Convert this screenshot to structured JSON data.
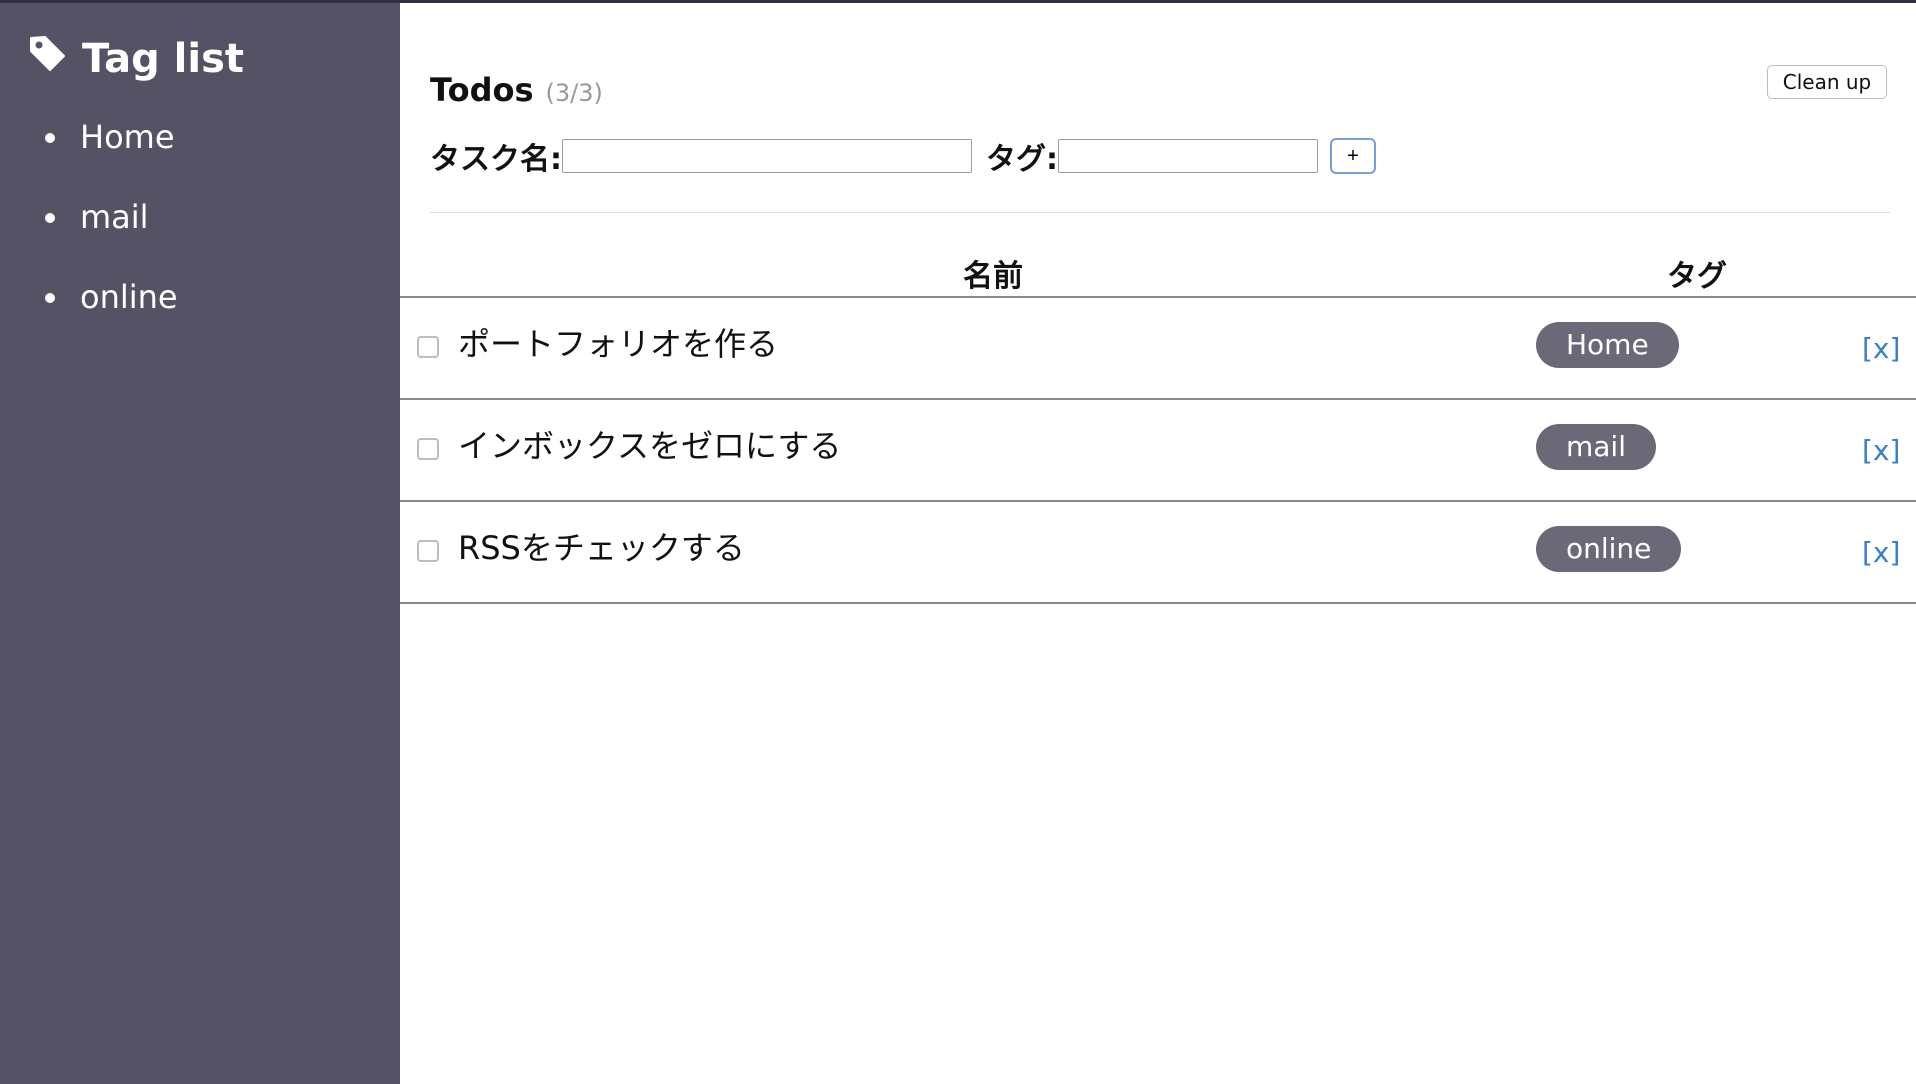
{
  "sidebar": {
    "title": "Tag list",
    "icon": "tag-icon",
    "items": [
      {
        "label": "Home"
      },
      {
        "label": "mail"
      },
      {
        "label": "online"
      }
    ]
  },
  "main": {
    "title": "Todos",
    "count": "(3/3)",
    "cleanup_label": "Clean up",
    "form": {
      "name_label": "タスク名:",
      "name_value": "",
      "tag_label": "タグ:",
      "tag_value": "",
      "add_label": "+"
    },
    "table": {
      "headers": {
        "name": "名前",
        "tag": "タグ"
      },
      "rows": [
        {
          "name": "ポートフォリオを作る",
          "tag": "Home",
          "delete": "[x]",
          "done": false
        },
        {
          "name": "インボックスをゼロにする",
          "tag": "mail",
          "delete": "[x]",
          "done": false
        },
        {
          "name": "RSSをチェックする",
          "tag": "online",
          "delete": "[x]",
          "done": false
        }
      ]
    }
  },
  "colors": {
    "sidebar_bg": "#545264",
    "tag_pill_bg": "#6b6878",
    "delete_link": "#3b7fc4"
  }
}
